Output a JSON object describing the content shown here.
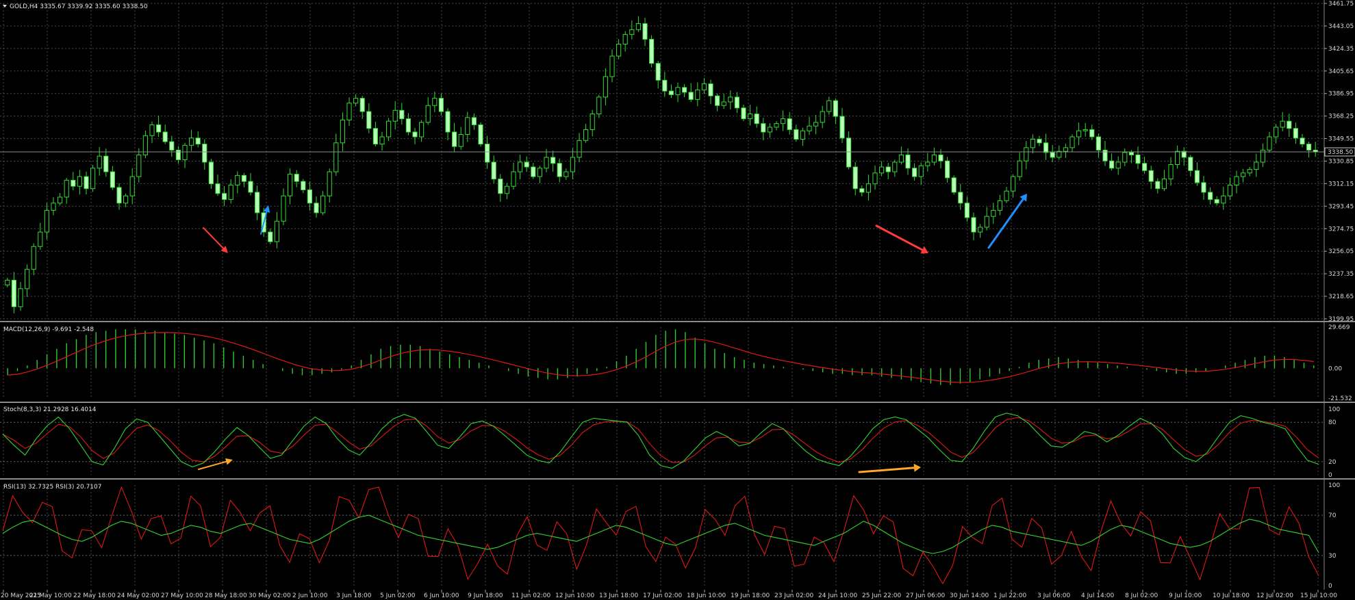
{
  "symbol_header": "GOLD,H4  3335.67 3339.92 3335.60 3338.50",
  "price_axis": {
    "ticks": [
      "3461.75",
      "3443.05",
      "3424.35",
      "3405.65",
      "3386.95",
      "3368.25",
      "3349.55",
      "3330.85",
      "3312.15",
      "3293.45",
      "3274.75",
      "3256.05",
      "3237.35",
      "3218.65",
      "3199.95"
    ],
    "current_price": "3338.50",
    "ylim": [
      3199.95,
      3461.75
    ]
  },
  "time_axis": [
    "20 May 2025",
    "21 May 10:00",
    "22 May 18:00",
    "24 May 02:00",
    "27 May 10:00",
    "28 May 18:00",
    "30 May 02:00",
    "2 Jun 10:00",
    "3 Jun 18:00",
    "5 Jun 02:00",
    "6 Jun 10:00",
    "9 Jun 18:00",
    "11 Jun 02:00",
    "12 Jun 10:00",
    "13 Jun 18:00",
    "17 Jun 02:00",
    "18 Jun 10:00",
    "19 Jun 18:00",
    "23 Jun 02:00",
    "24 Jun 10:00",
    "25 Jun 22:00",
    "27 Jun 06:00",
    "30 Jun 14:00",
    "1 Jul 22:00",
    "3 Jul 06:00",
    "4 Jul 14:00",
    "8 Jul 02:00",
    "9 Jul 10:00",
    "10 Jul 18:00",
    "12 Jul 02:00",
    "15 Jul 10:00"
  ],
  "macd": {
    "label": "MACD(12,26,9) -9.691 -2.548",
    "ticks": [
      "29.669",
      "0.00",
      "-21.532"
    ]
  },
  "stoch": {
    "label": "Stoch(8,3,3) 21.2928 16.4014",
    "ticks": [
      "100",
      "80",
      "20",
      "0"
    ]
  },
  "rsi": {
    "label": "RSI(13) 32.7325  RSI(3) 20.7107",
    "ticks": [
      "100",
      "70",
      "30",
      "0"
    ]
  },
  "colors": {
    "background": "#000000",
    "grid": "#4a4a4a",
    "bull_body": "#000000",
    "bear_body": "#b8ffb8",
    "wick": "#33dd33",
    "macd_hist": "#2ecc2e",
    "signal": "#e01818",
    "arrow_red": "#ff3b3b",
    "arrow_blue": "#1e90ff",
    "arrow_orange": "#ffa726"
  },
  "chart_data": [
    {
      "type": "candlestick",
      "title": "GOLD,H4",
      "ylim": [
        3199.95,
        3461.75
      ],
      "close": [
        3232,
        3210,
        3225,
        3241,
        3260,
        3272,
        3290,
        3296,
        3301,
        3315,
        3310,
        3318,
        3308,
        3325,
        3335,
        3322,
        3309,
        3296,
        3302,
        3318,
        3336,
        3352,
        3361,
        3355,
        3347,
        3340,
        3332,
        3344,
        3350,
        3345,
        3330,
        3312,
        3304,
        3299,
        3311,
        3319,
        3314,
        3305,
        3288,
        3272,
        3264,
        3281,
        3302,
        3320,
        3314,
        3307,
        3296,
        3288,
        3302,
        3322,
        3346,
        3365,
        3379,
        3383,
        3372,
        3358,
        3345,
        3351,
        3364,
        3373,
        3366,
        3355,
        3351,
        3363,
        3377,
        3383,
        3372,
        3355,
        3343,
        3353,
        3367,
        3361,
        3345,
        3330,
        3316,
        3304,
        3310,
        3322,
        3330,
        3326,
        3318,
        3325,
        3334,
        3329,
        3318,
        3322,
        3334,
        3348,
        3357,
        3370,
        3384,
        3401,
        3418,
        3428,
        3436,
        3440,
        3445,
        3432,
        3412,
        3398,
        3389,
        3386,
        3392,
        3388,
        3382,
        3390,
        3395,
        3385,
        3377,
        3380,
        3384,
        3375,
        3366,
        3370,
        3362,
        3355,
        3359,
        3362,
        3366,
        3357,
        3349,
        3356,
        3360,
        3363,
        3372,
        3381,
        3368,
        3350,
        3326,
        3308,
        3305,
        3312,
        3321,
        3326,
        3322,
        3330,
        3336,
        3325,
        3318,
        3327,
        3330,
        3336,
        3331,
        3317,
        3305,
        3296,
        3284,
        3272,
        3276,
        3285,
        3290,
        3298,
        3306,
        3318,
        3331,
        3342,
        3349,
        3346,
        3338,
        3334,
        3339,
        3342,
        3351,
        3356,
        3357,
        3351,
        3340,
        3331,
        3325,
        3330,
        3338,
        3336,
        3329,
        3323,
        3314,
        3308,
        3316,
        3328,
        3339,
        3334,
        3323,
        3313,
        3305,
        3299,
        3296,
        3302,
        3311,
        3318,
        3321,
        3324,
        3330,
        3340,
        3351,
        3359,
        3364,
        3358,
        3350,
        3345,
        3340,
        3338.5
      ]
    },
    {
      "type": "bar",
      "name": "MACD(12,26,9)",
      "ylim": [
        -21.532,
        29.669
      ],
      "values": [
        -5,
        -2,
        2,
        6,
        10,
        14,
        18,
        21,
        24,
        26,
        27,
        28,
        28,
        28,
        27,
        27,
        26,
        25,
        24,
        22,
        20,
        18,
        15,
        12,
        9,
        6,
        3,
        0,
        -2,
        -4,
        -5,
        -5,
        -4,
        -3,
        -1,
        2,
        6,
        10,
        14,
        16,
        17,
        17,
        16,
        14,
        12,
        10,
        8,
        6,
        4,
        2,
        0,
        -2,
        -4,
        -6,
        -7,
        -8,
        -8,
        -7,
        -6,
        -4,
        -2,
        1,
        5,
        9,
        14,
        19,
        24,
        27,
        28,
        26,
        22,
        18,
        14,
        11,
        8,
        6,
        4,
        3,
        2,
        1,
        0,
        -1,
        -2,
        -3,
        -4,
        -4,
        -5,
        -5,
        -5,
        -6,
        -7,
        -8,
        -9,
        -10,
        -11,
        -12,
        -12,
        -11,
        -10,
        -8,
        -6,
        -4,
        -2,
        1,
        4,
        6,
        7,
        8,
        7,
        6,
        5,
        4,
        3,
        2,
        1,
        0,
        -1,
        -2,
        -3,
        -4,
        -4,
        -3,
        -2,
        0,
        2,
        4,
        6,
        8,
        9,
        9,
        8,
        6,
        4,
        2
      ]
    },
    {
      "type": "line",
      "name": "Stoch(8,3,3)",
      "ylim": [
        0,
        100
      ],
      "values": [
        62,
        45,
        30,
        55,
        75,
        88,
        70,
        45,
        20,
        15,
        40,
        70,
        85,
        80,
        60,
        40,
        20,
        12,
        18,
        35,
        55,
        72,
        60,
        42,
        25,
        30,
        52,
        74,
        88,
        78,
        55,
        38,
        30,
        48,
        70,
        85,
        92,
        86,
        66,
        45,
        40,
        58,
        78,
        82,
        74,
        60,
        45,
        30,
        22,
        18,
        35,
        58,
        80,
        86,
        84,
        82,
        80,
        60,
        30,
        14,
        10,
        20,
        38,
        56,
        66,
        58,
        44,
        48,
        64,
        78,
        70,
        52,
        36,
        24,
        18,
        14,
        28,
        48,
        70,
        84,
        88,
        84,
        70,
        56,
        38,
        22,
        20,
        40,
        66,
        88,
        94,
        90,
        78,
        60,
        44,
        42,
        52,
        66,
        62,
        50,
        60,
        74,
        86,
        78,
        62,
        40,
        26,
        20,
        34,
        58,
        80,
        90,
        86,
        80,
        76,
        70,
        44,
        22,
        16
      ]
    },
    {
      "type": "line",
      "name": "RSI(13)",
      "ylim": [
        0,
        100
      ],
      "values": [
        52,
        58,
        63,
        65,
        60,
        55,
        50,
        46,
        44,
        48,
        54,
        60,
        64,
        62,
        58,
        54,
        50,
        52,
        56,
        60,
        58,
        54,
        52,
        56,
        60,
        62,
        58,
        54,
        50,
        46,
        44,
        42,
        46,
        52,
        58,
        64,
        68,
        70,
        66,
        62,
        58,
        54,
        50,
        48,
        46,
        44,
        42,
        40,
        38,
        36,
        38,
        42,
        46,
        50,
        52,
        50,
        48,
        46,
        44,
        48,
        52,
        56,
        60,
        58,
        54,
        50,
        46,
        42,
        40,
        44,
        48,
        52,
        56,
        60,
        62,
        58,
        54,
        50,
        48,
        46,
        44,
        42,
        40,
        44,
        48,
        52,
        58,
        64,
        60,
        54,
        48,
        42,
        38,
        34,
        32,
        34,
        38,
        44,
        50,
        56,
        60,
        58,
        54,
        52,
        50,
        48,
        46,
        44,
        42,
        40,
        44,
        50,
        56,
        60,
        58,
        54,
        50,
        46,
        42,
        40,
        38,
        40,
        44,
        50,
        56,
        62,
        66,
        64,
        60,
        56,
        54,
        52,
        50,
        32.7
      ]
    }
  ]
}
